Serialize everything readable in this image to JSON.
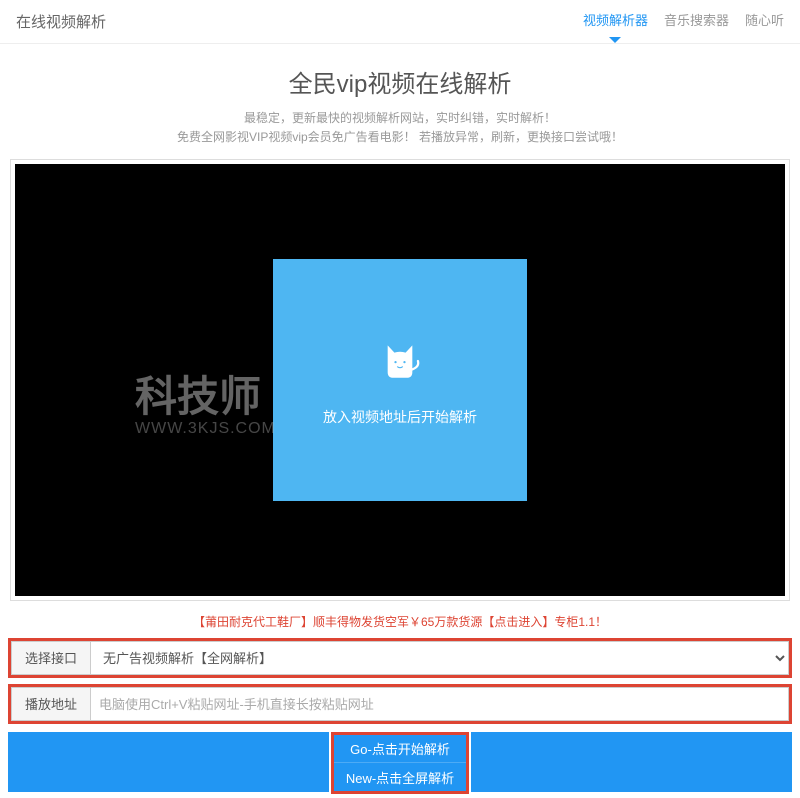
{
  "header": {
    "title": "在线视频解析",
    "nav": [
      {
        "label": "视频解析器",
        "active": true
      },
      {
        "label": "音乐搜索器",
        "active": false
      },
      {
        "label": "随心听",
        "active": false
      }
    ]
  },
  "main": {
    "title": "全民vip视频在线解析",
    "subtitle1": "最稳定，更新最快的视频解析网站，实时纠错，实时解析！",
    "subtitle2": "免费全网影视VIP视频vip会员免广告看电影！ 若播放异常，刷新，更换接口尝试哦！"
  },
  "player": {
    "hint": "放入视频地址后开始解析"
  },
  "watermark": {
    "main": "科技师",
    "sub": "WWW.3KJS.COM"
  },
  "promo": "【莆田耐克代工鞋厂】顺丰得物发货空军￥65万款货源【点击进入】专柜1.1！",
  "form": {
    "interface_label": "选择接口",
    "interface_option": "无广告视频解析【全网解析】",
    "address_label": "播放地址",
    "address_placeholder": "电脑使用Ctrl+V粘贴网址-手机直接长按粘贴网址"
  },
  "buttons": {
    "go": "Go-点击开始解析",
    "new": "New-点击全屏解析"
  }
}
